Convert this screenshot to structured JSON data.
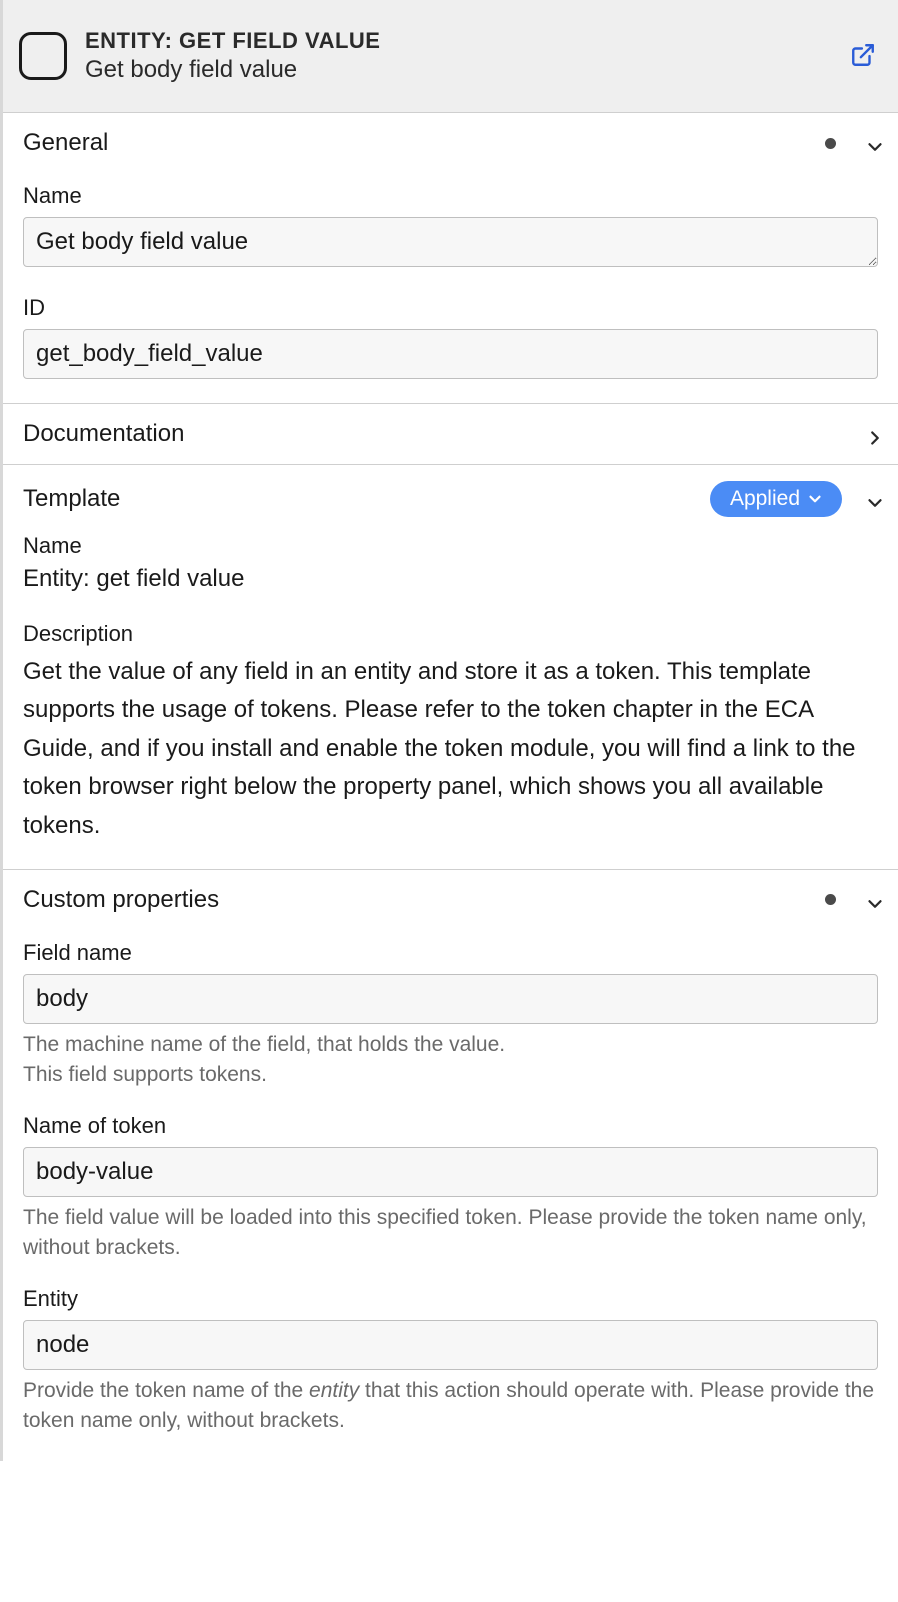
{
  "header": {
    "title": "ENTITY: GET FIELD VALUE",
    "subtitle": "Get body field value"
  },
  "sections": {
    "general": {
      "title": "General",
      "name_label": "Name",
      "name_value": "Get body field value",
      "id_label": "ID",
      "id_value": "get_body_field_value"
    },
    "documentation": {
      "title": "Documentation"
    },
    "template": {
      "title": "Template",
      "badge": "Applied",
      "name_label": "Name",
      "name_value": "Entity: get field value",
      "desc_label": "Description",
      "desc_text": "Get the value of any field in an entity and store it as a token. This template supports the usage of tokens. Please refer to the token chapter in the ECA Guide, and if you install and enable the token module, you will find a link to the token browser right below the property panel, which shows you all available tokens."
    },
    "custom": {
      "title": "Custom properties",
      "field_name_label": "Field name",
      "field_name_value": "body",
      "field_name_help1": "The machine name of the field, that holds the value.",
      "field_name_help2": "This field supports tokens.",
      "token_label": "Name of token",
      "token_value": "body-value",
      "token_help": "The field value will be loaded into this specified token. Please provide the token name only, without brackets.",
      "entity_label": "Entity",
      "entity_value": "node",
      "entity_help_pre": "Provide the token name of the ",
      "entity_help_em": "entity",
      "entity_help_post": " that this action should operate with. Please provide the token name only, without brackets."
    }
  }
}
